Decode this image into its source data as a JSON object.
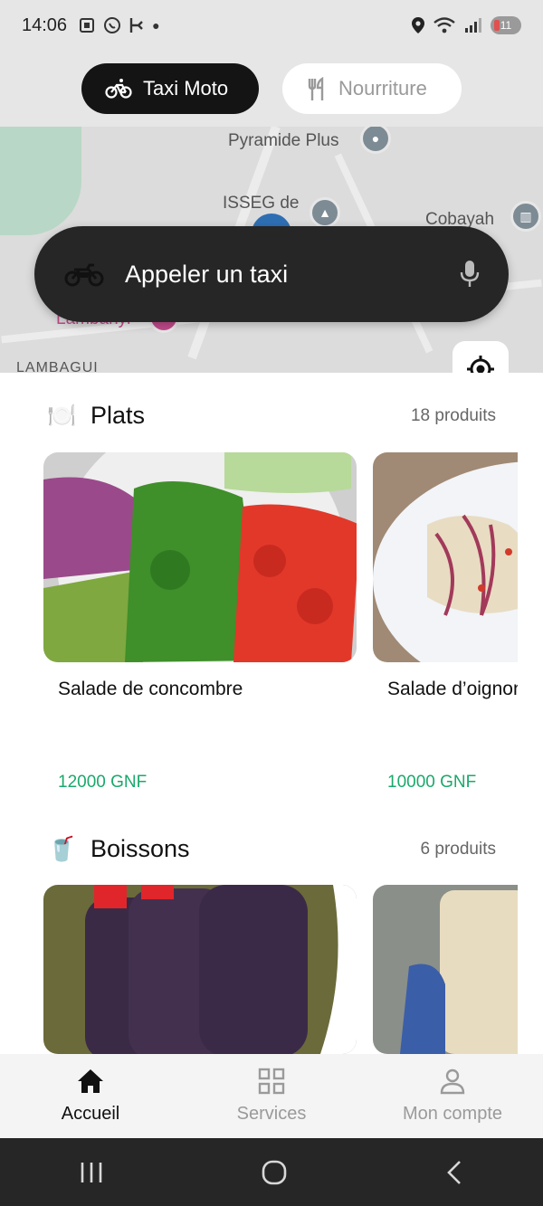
{
  "status_bar": {
    "time": "14:06",
    "battery": "11"
  },
  "mode_selector": {
    "active_label": "Taxi Moto",
    "inactive_label": "Nourriture"
  },
  "map": {
    "labels": [
      "Pyramide Plus",
      "ISSEG de",
      "Lam",
      "yi",
      "Cobayah",
      "Lambanyi",
      "LAMBAGUI"
    ]
  },
  "taxi_bar": {
    "label": "Appeler un taxi"
  },
  "sections": [
    {
      "title": "Plats",
      "count": "18 produits",
      "items": [
        {
          "name": "Salade de concombre",
          "price": "12000 GNF"
        },
        {
          "name": "Salade d’oignon",
          "price": "10000 GNF"
        }
      ]
    },
    {
      "title": "Boissons",
      "count": "6 produits",
      "items": [
        {
          "name": ""
        },
        {
          "name": ""
        }
      ]
    }
  ],
  "bottom_nav": {
    "home": "Accueil",
    "services": "Services",
    "account": "Mon compte"
  },
  "colors": {
    "price": "#1aa96b",
    "dark": "#141414",
    "marker": "#2e6fb4"
  }
}
